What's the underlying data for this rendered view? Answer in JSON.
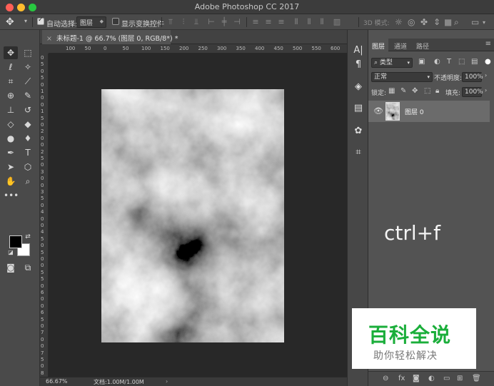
{
  "window": {
    "title": "Adobe Photoshop CC 2017"
  },
  "options_bar": {
    "auto_select_label": "自动选择:",
    "auto_select_value": "图层",
    "show_transform_label": "显示变换控件",
    "mode_3d_label": "3D 模式:"
  },
  "document": {
    "tab_label": "未标题-1 @ 66.7% (图层 0, RGB/8*) *",
    "ruler_h": [
      "100",
      "50",
      "0",
      "50",
      "100",
      "150",
      "200",
      "250",
      "300",
      "350",
      "400",
      "450",
      "500",
      "550",
      "600"
    ],
    "ruler_v": [
      "0",
      "5",
      "0",
      "5",
      "0",
      "1",
      "0",
      "0",
      "1",
      "5",
      "0",
      "2",
      "0",
      "0",
      "2",
      "5",
      "0",
      "3",
      "0",
      "0",
      "3",
      "5",
      "0",
      "4",
      "0",
      "0",
      "4",
      "5",
      "0",
      "5",
      "0",
      "0",
      "5",
      "5",
      "0",
      "6",
      "0",
      "0",
      "6",
      "5",
      "0",
      "7",
      "0",
      "0",
      "7",
      "5",
      "0",
      "8"
    ]
  },
  "status_bar": {
    "zoom": "66.67%",
    "doc_info": "文档:1.00M/1.00M"
  },
  "layers_panel": {
    "tabs": [
      "图层",
      "通道",
      "路径"
    ],
    "filter_type": "类型",
    "blend_mode": "正常",
    "opacity_label": "不透明度:",
    "opacity_value": "100%",
    "lock_label": "锁定:",
    "fill_label": "填充:",
    "fill_value": "100%",
    "layer_name": "图层 0",
    "overlay_text": "ctrl+f"
  },
  "watermark": {
    "title": "百科全说",
    "subtitle": "助你轻松解决"
  },
  "colors": {
    "foreground": "#000000",
    "background": "#ffffff",
    "accent_green": "#1aae3a"
  }
}
